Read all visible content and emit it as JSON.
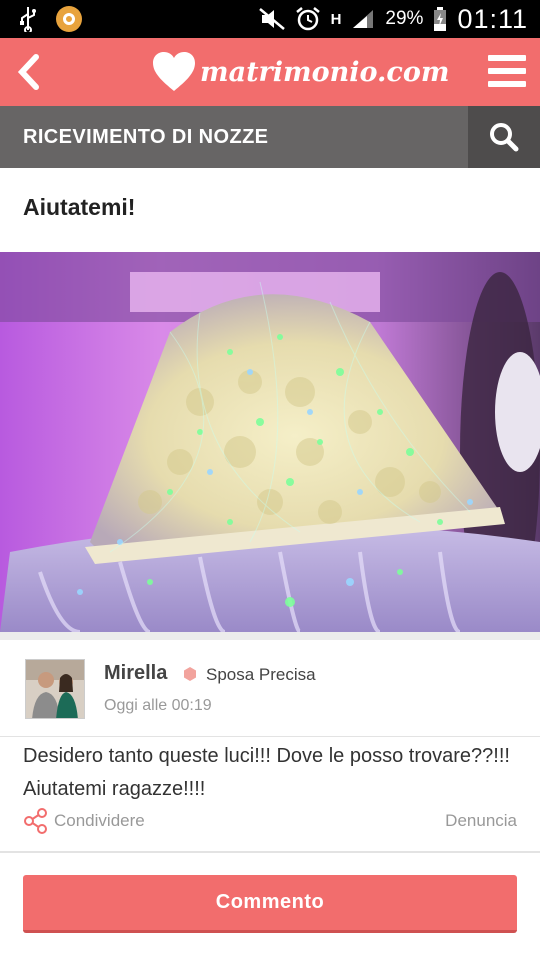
{
  "status_bar": {
    "battery_percent": "29%",
    "time": "01:11",
    "network_type": "H",
    "icons": [
      "usb-icon",
      "app-badge-icon",
      "muted-icon",
      "alarm-icon",
      "signal-icon",
      "battery-icon"
    ]
  },
  "header": {
    "logo_text": "matrimonio.com",
    "back_icon": "chevron-left-icon",
    "menu_icon": "hamburger-icon",
    "brand_color": "#f26d6d"
  },
  "section": {
    "title": "RICEVIMENTO DI NOZZE",
    "search_icon": "search-icon"
  },
  "post": {
    "title": "Aiutatemi!",
    "author": {
      "name": "Mirella",
      "rank": "Sposa Precisa",
      "time": "Oggi alle 00:19"
    },
    "body": "Desidero tanto queste luci!!! Dove le posso trovare??!!! Aiutatemi ragazze!!!!",
    "share_label": "Condividere",
    "report_label": "Denuncia"
  },
  "actions": {
    "comment_label": "Commento"
  }
}
